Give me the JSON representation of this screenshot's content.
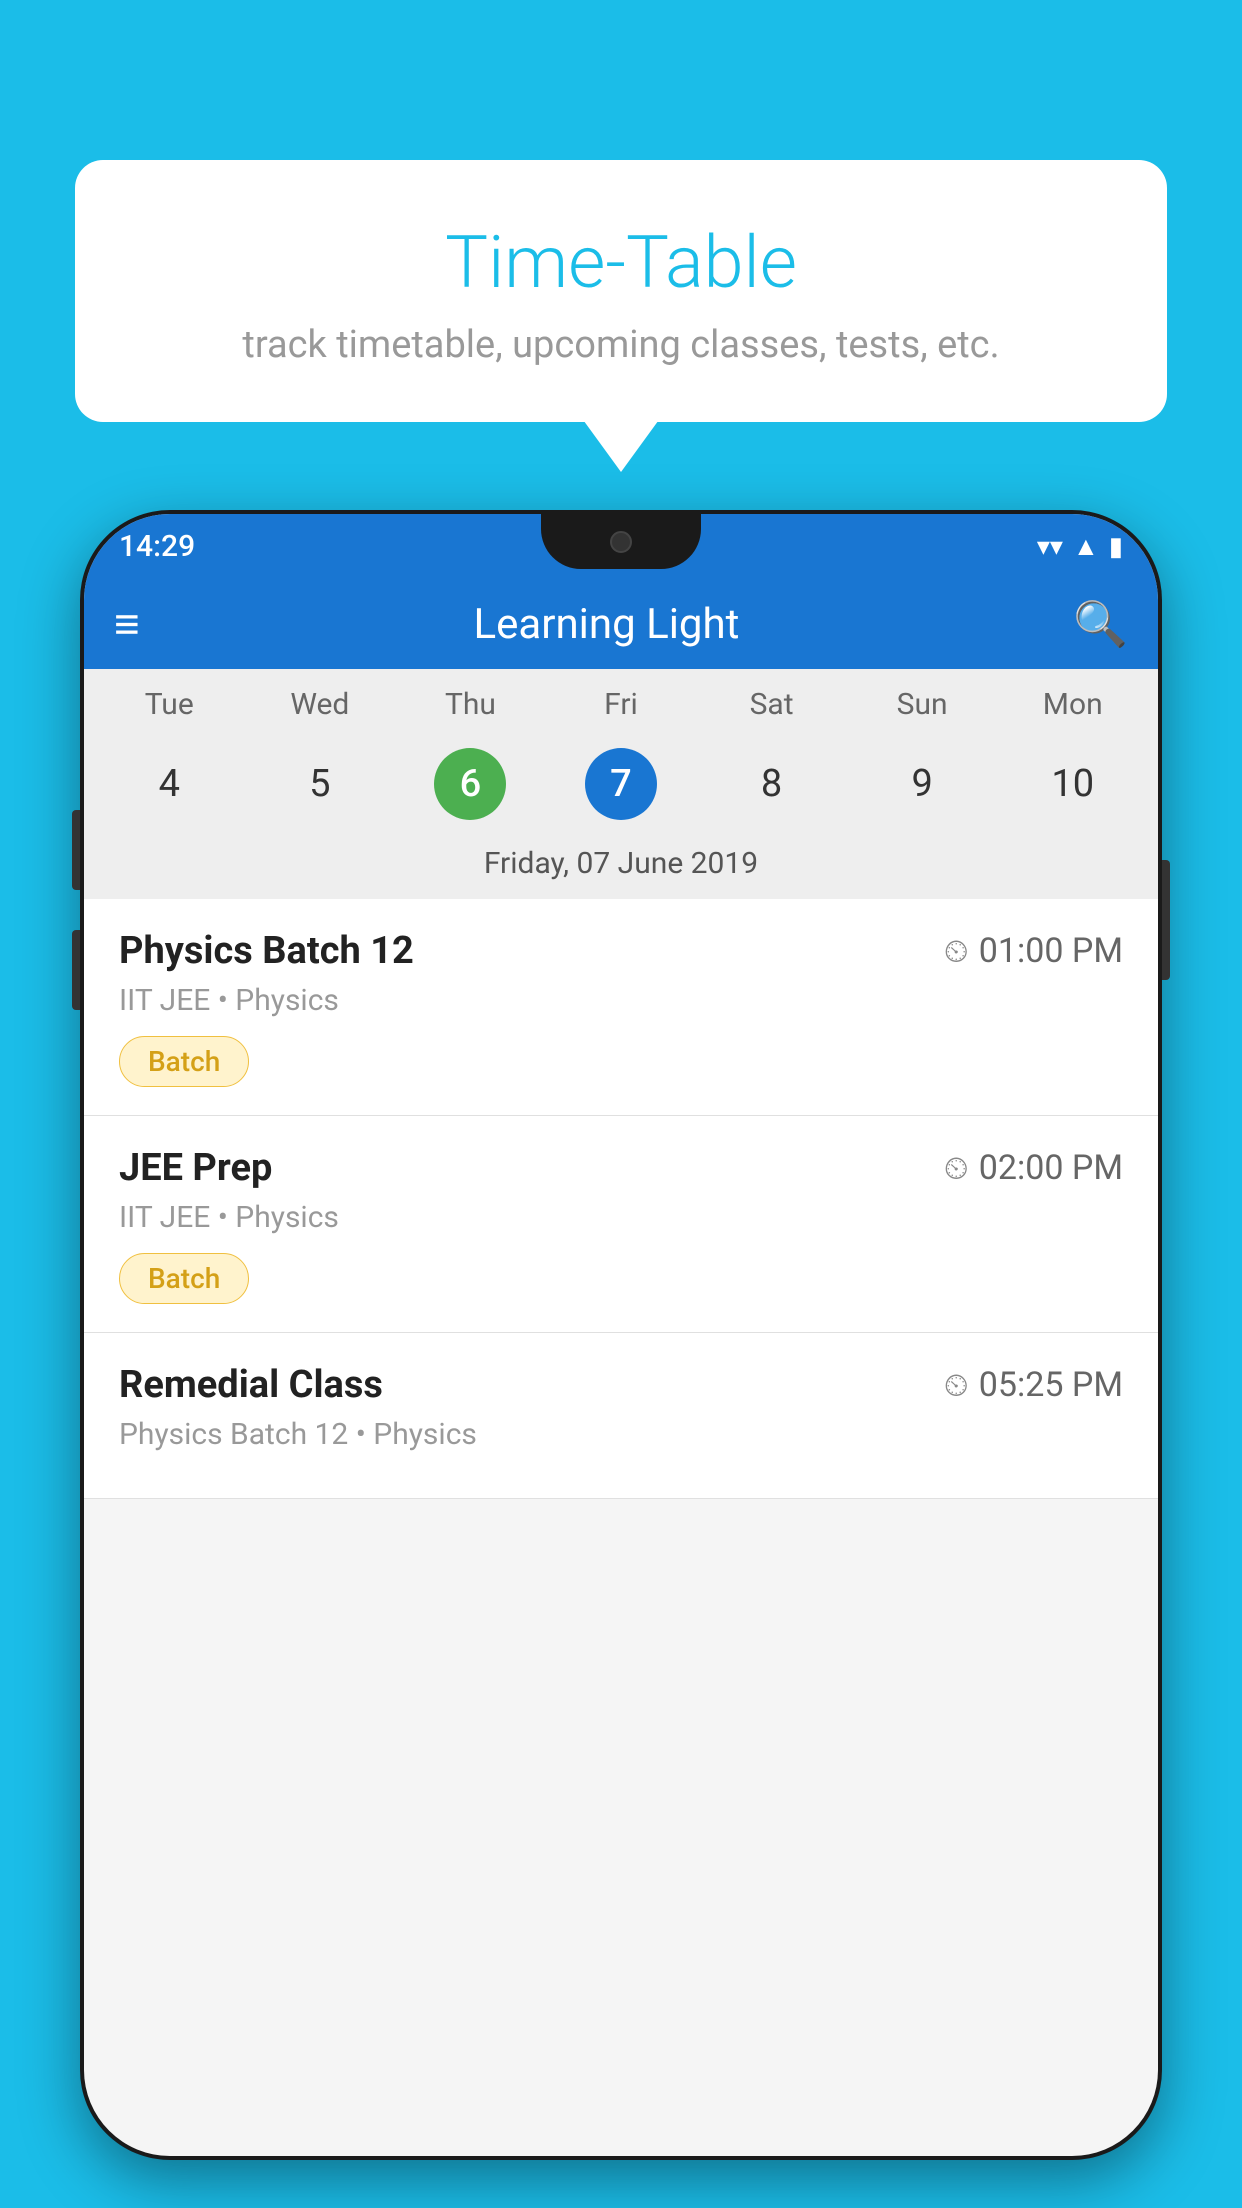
{
  "background_color": "#1BBDE8",
  "speech_bubble": {
    "title": "Time-Table",
    "subtitle": "track timetable, upcoming classes, tests, etc."
  },
  "phone": {
    "status_bar": {
      "time": "14:29"
    },
    "nav_bar": {
      "title": "Learning Light",
      "menu_icon": "≡",
      "search_icon": "🔍"
    },
    "calendar": {
      "days": [
        "Tue",
        "Wed",
        "Thu",
        "Fri",
        "Sat",
        "Sun",
        "Mon"
      ],
      "dates": [
        "4",
        "5",
        "6",
        "7",
        "8",
        "9",
        "10"
      ],
      "today_index": 2,
      "selected_index": 3,
      "selected_label": "Friday, 07 June 2019"
    },
    "schedule": [
      {
        "title": "Physics Batch 12",
        "time": "01:00 PM",
        "subtitle": "IIT JEE • Physics",
        "badge": "Batch"
      },
      {
        "title": "JEE Prep",
        "time": "02:00 PM",
        "subtitle": "IIT JEE • Physics",
        "badge": "Batch"
      },
      {
        "title": "Remedial Class",
        "time": "05:25 PM",
        "subtitle": "Physics Batch 12 • Physics",
        "badge": null
      }
    ]
  }
}
